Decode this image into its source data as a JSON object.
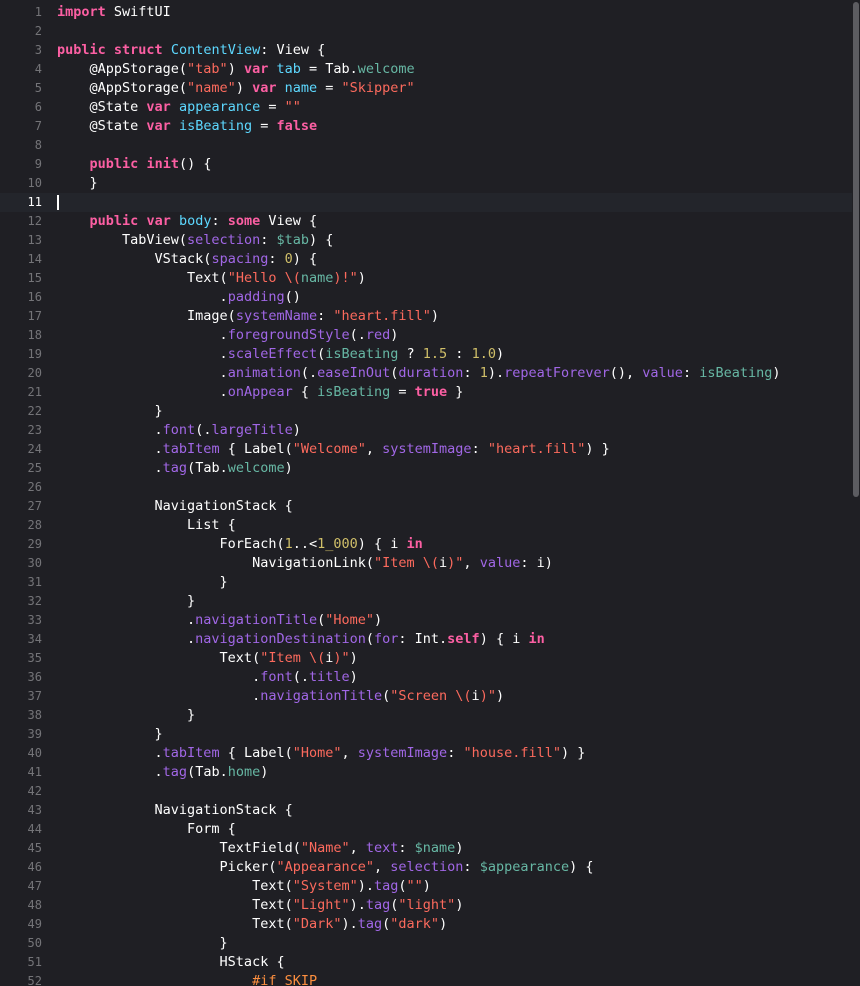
{
  "editor": {
    "current_line": 11,
    "lines": [
      {
        "n": "1",
        "t": [
          [
            "import",
            "kw"
          ],
          [
            " SwiftUI",
            "pl"
          ]
        ]
      },
      {
        "n": "2",
        "t": []
      },
      {
        "n": "3",
        "t": [
          [
            "public",
            "kw"
          ],
          [
            " ",
            "pl"
          ],
          [
            "struct",
            "kw"
          ],
          [
            " ",
            "pl"
          ],
          [
            "ContentView",
            "typ"
          ],
          [
            ": View {",
            "pl"
          ]
        ]
      },
      {
        "n": "4",
        "t": [
          [
            "    @AppStorage(",
            "pl"
          ],
          [
            "\"tab\"",
            "str"
          ],
          [
            ") ",
            "pl"
          ],
          [
            "var",
            "kw"
          ],
          [
            " ",
            "pl"
          ],
          [
            "tab",
            "typ"
          ],
          [
            " = Tab.",
            "pl"
          ],
          [
            "welcome",
            "prop"
          ]
        ]
      },
      {
        "n": "5",
        "t": [
          [
            "    @AppStorage(",
            "pl"
          ],
          [
            "\"name\"",
            "str"
          ],
          [
            ") ",
            "pl"
          ],
          [
            "var",
            "kw"
          ],
          [
            " ",
            "pl"
          ],
          [
            "name",
            "typ"
          ],
          [
            " = ",
            "pl"
          ],
          [
            "\"Skipper\"",
            "str"
          ]
        ]
      },
      {
        "n": "6",
        "t": [
          [
            "    @State ",
            "pl"
          ],
          [
            "var",
            "kw"
          ],
          [
            " ",
            "pl"
          ],
          [
            "appearance",
            "typ"
          ],
          [
            " = ",
            "pl"
          ],
          [
            "\"\"",
            "str"
          ]
        ]
      },
      {
        "n": "7",
        "t": [
          [
            "    @State ",
            "pl"
          ],
          [
            "var",
            "kw"
          ],
          [
            " ",
            "pl"
          ],
          [
            "isBeating",
            "typ"
          ],
          [
            " = ",
            "pl"
          ],
          [
            "false",
            "kw"
          ]
        ]
      },
      {
        "n": "8",
        "t": []
      },
      {
        "n": "9",
        "t": [
          [
            "    ",
            "pl"
          ],
          [
            "public",
            "kw"
          ],
          [
            " ",
            "pl"
          ],
          [
            "init",
            "kw"
          ],
          [
            "() {",
            "pl"
          ]
        ]
      },
      {
        "n": "10",
        "t": [
          [
            "    }",
            "pl"
          ]
        ]
      },
      {
        "n": "11",
        "t": []
      },
      {
        "n": "12",
        "t": [
          [
            "    ",
            "pl"
          ],
          [
            "public",
            "kw"
          ],
          [
            " ",
            "pl"
          ],
          [
            "var",
            "kw"
          ],
          [
            " ",
            "pl"
          ],
          [
            "body",
            "typ"
          ],
          [
            ": ",
            "pl"
          ],
          [
            "some",
            "kw"
          ],
          [
            " View {",
            "pl"
          ]
        ]
      },
      {
        "n": "13",
        "t": [
          [
            "        TabView(",
            "pl"
          ],
          [
            "selection",
            "fn"
          ],
          [
            ": ",
            "pl"
          ],
          [
            "$tab",
            "prop"
          ],
          [
            ") {",
            "pl"
          ]
        ]
      },
      {
        "n": "14",
        "t": [
          [
            "            VStack(",
            "pl"
          ],
          [
            "spacing",
            "fn"
          ],
          [
            ": ",
            "pl"
          ],
          [
            "0",
            "num"
          ],
          [
            ") {",
            "pl"
          ]
        ]
      },
      {
        "n": "15",
        "t": [
          [
            "                Text(",
            "pl"
          ],
          [
            "\"Hello \\(",
            "str"
          ],
          [
            "name",
            "prop"
          ],
          [
            ")!\"",
            "str"
          ],
          [
            ")",
            "pl"
          ]
        ]
      },
      {
        "n": "16",
        "t": [
          [
            "                    .",
            "pl"
          ],
          [
            "padding",
            "fn"
          ],
          [
            "()",
            "pl"
          ]
        ]
      },
      {
        "n": "17",
        "t": [
          [
            "                Image(",
            "pl"
          ],
          [
            "systemName",
            "fn"
          ],
          [
            ": ",
            "pl"
          ],
          [
            "\"heart.fill\"",
            "str"
          ],
          [
            ")",
            "pl"
          ]
        ]
      },
      {
        "n": "18",
        "t": [
          [
            "                    .",
            "pl"
          ],
          [
            "foregroundStyle",
            "fn"
          ],
          [
            "(.",
            "pl"
          ],
          [
            "red",
            "fn"
          ],
          [
            ")",
            "pl"
          ]
        ]
      },
      {
        "n": "19",
        "t": [
          [
            "                    .",
            "pl"
          ],
          [
            "scaleEffect",
            "fn"
          ],
          [
            "(",
            "pl"
          ],
          [
            "isBeating",
            "prop"
          ],
          [
            " ? ",
            "pl"
          ],
          [
            "1.5",
            "num"
          ],
          [
            " : ",
            "pl"
          ],
          [
            "1.0",
            "num"
          ],
          [
            ")",
            "pl"
          ]
        ]
      },
      {
        "n": "20",
        "t": [
          [
            "                    .",
            "pl"
          ],
          [
            "animation",
            "fn"
          ],
          [
            "(.",
            "pl"
          ],
          [
            "easeInOut",
            "fn"
          ],
          [
            "(",
            "pl"
          ],
          [
            "duration",
            "fn"
          ],
          [
            ": ",
            "pl"
          ],
          [
            "1",
            "num"
          ],
          [
            ").",
            "pl"
          ],
          [
            "repeatForever",
            "fn"
          ],
          [
            "(), ",
            "pl"
          ],
          [
            "value",
            "fn"
          ],
          [
            ": ",
            "pl"
          ],
          [
            "isBeating",
            "prop"
          ],
          [
            ")",
            "pl"
          ]
        ]
      },
      {
        "n": "21",
        "t": [
          [
            "                    .",
            "pl"
          ],
          [
            "onAppear",
            "fn"
          ],
          [
            " { ",
            "pl"
          ],
          [
            "isBeating",
            "prop"
          ],
          [
            " = ",
            "pl"
          ],
          [
            "true",
            "kw"
          ],
          [
            " }",
            "pl"
          ]
        ]
      },
      {
        "n": "22",
        "t": [
          [
            "            }",
            "pl"
          ]
        ]
      },
      {
        "n": "23",
        "t": [
          [
            "            .",
            "pl"
          ],
          [
            "font",
            "fn"
          ],
          [
            "(.",
            "pl"
          ],
          [
            "largeTitle",
            "fn"
          ],
          [
            ")",
            "pl"
          ]
        ]
      },
      {
        "n": "24",
        "t": [
          [
            "            .",
            "pl"
          ],
          [
            "tabItem",
            "fn"
          ],
          [
            " { Label(",
            "pl"
          ],
          [
            "\"Welcome\"",
            "str"
          ],
          [
            ", ",
            "pl"
          ],
          [
            "systemImage",
            "fn"
          ],
          [
            ": ",
            "pl"
          ],
          [
            "\"heart.fill\"",
            "str"
          ],
          [
            ") }",
            "pl"
          ]
        ]
      },
      {
        "n": "25",
        "t": [
          [
            "            .",
            "pl"
          ],
          [
            "tag",
            "fn"
          ],
          [
            "(Tab.",
            "pl"
          ],
          [
            "welcome",
            "prop"
          ],
          [
            ")",
            "pl"
          ]
        ]
      },
      {
        "n": "26",
        "t": []
      },
      {
        "n": "27",
        "t": [
          [
            "            NavigationStack {",
            "pl"
          ]
        ]
      },
      {
        "n": "28",
        "t": [
          [
            "                List {",
            "pl"
          ]
        ]
      },
      {
        "n": "29",
        "t": [
          [
            "                    ForEach(",
            "pl"
          ],
          [
            "1",
            "num"
          ],
          [
            "..<",
            "pl"
          ],
          [
            "1_000",
            "num"
          ],
          [
            ") { i ",
            "pl"
          ],
          [
            "in",
            "kw"
          ]
        ]
      },
      {
        "n": "30",
        "t": [
          [
            "                        NavigationLink(",
            "pl"
          ],
          [
            "\"Item \\(",
            "str"
          ],
          [
            "i",
            "pl"
          ],
          [
            ")\"",
            "str"
          ],
          [
            ", ",
            "pl"
          ],
          [
            "value",
            "fn"
          ],
          [
            ": i)",
            "pl"
          ]
        ]
      },
      {
        "n": "31",
        "t": [
          [
            "                    }",
            "pl"
          ]
        ]
      },
      {
        "n": "32",
        "t": [
          [
            "                }",
            "pl"
          ]
        ]
      },
      {
        "n": "33",
        "t": [
          [
            "                .",
            "pl"
          ],
          [
            "navigationTitle",
            "fn"
          ],
          [
            "(",
            "pl"
          ],
          [
            "\"Home\"",
            "str"
          ],
          [
            ")",
            "pl"
          ]
        ]
      },
      {
        "n": "34",
        "t": [
          [
            "                .",
            "pl"
          ],
          [
            "navigationDestination",
            "fn"
          ],
          [
            "(",
            "pl"
          ],
          [
            "for",
            "fn"
          ],
          [
            ": Int.",
            "pl"
          ],
          [
            "self",
            "kw"
          ],
          [
            ") { i ",
            "pl"
          ],
          [
            "in",
            "kw"
          ]
        ]
      },
      {
        "n": "35",
        "t": [
          [
            "                    Text(",
            "pl"
          ],
          [
            "\"Item \\(",
            "str"
          ],
          [
            "i",
            "pl"
          ],
          [
            ")\"",
            "str"
          ],
          [
            ")",
            "pl"
          ]
        ]
      },
      {
        "n": "36",
        "t": [
          [
            "                        .",
            "pl"
          ],
          [
            "font",
            "fn"
          ],
          [
            "(.",
            "pl"
          ],
          [
            "title",
            "fn"
          ],
          [
            ")",
            "pl"
          ]
        ]
      },
      {
        "n": "37",
        "t": [
          [
            "                        .",
            "pl"
          ],
          [
            "navigationTitle",
            "fn"
          ],
          [
            "(",
            "pl"
          ],
          [
            "\"Screen \\(",
            "str"
          ],
          [
            "i",
            "pl"
          ],
          [
            ")\"",
            "str"
          ],
          [
            ")",
            "pl"
          ]
        ]
      },
      {
        "n": "38",
        "t": [
          [
            "                }",
            "pl"
          ]
        ]
      },
      {
        "n": "39",
        "t": [
          [
            "            }",
            "pl"
          ]
        ]
      },
      {
        "n": "40",
        "t": [
          [
            "            .",
            "pl"
          ],
          [
            "tabItem",
            "fn"
          ],
          [
            " { Label(",
            "pl"
          ],
          [
            "\"Home\"",
            "str"
          ],
          [
            ", ",
            "pl"
          ],
          [
            "systemImage",
            "fn"
          ],
          [
            ": ",
            "pl"
          ],
          [
            "\"house.fill\"",
            "str"
          ],
          [
            ") }",
            "pl"
          ]
        ]
      },
      {
        "n": "41",
        "t": [
          [
            "            .",
            "pl"
          ],
          [
            "tag",
            "fn"
          ],
          [
            "(Tab.",
            "pl"
          ],
          [
            "home",
            "prop"
          ],
          [
            ")",
            "pl"
          ]
        ]
      },
      {
        "n": "42",
        "t": []
      },
      {
        "n": "43",
        "t": [
          [
            "            NavigationStack {",
            "pl"
          ]
        ]
      },
      {
        "n": "44",
        "t": [
          [
            "                Form {",
            "pl"
          ]
        ]
      },
      {
        "n": "45",
        "t": [
          [
            "                    TextField(",
            "pl"
          ],
          [
            "\"Name\"",
            "str"
          ],
          [
            ", ",
            "pl"
          ],
          [
            "text",
            "fn"
          ],
          [
            ": ",
            "pl"
          ],
          [
            "$name",
            "prop"
          ],
          [
            ")",
            "pl"
          ]
        ]
      },
      {
        "n": "46",
        "t": [
          [
            "                    Picker(",
            "pl"
          ],
          [
            "\"Appearance\"",
            "str"
          ],
          [
            ", ",
            "pl"
          ],
          [
            "selection",
            "fn"
          ],
          [
            ": ",
            "pl"
          ],
          [
            "$appearance",
            "prop"
          ],
          [
            ") {",
            "pl"
          ]
        ]
      },
      {
        "n": "47",
        "t": [
          [
            "                        Text(",
            "pl"
          ],
          [
            "\"System\"",
            "str"
          ],
          [
            ").",
            "pl"
          ],
          [
            "tag",
            "fn"
          ],
          [
            "(",
            "pl"
          ],
          [
            "\"\"",
            "str"
          ],
          [
            ")",
            "pl"
          ]
        ]
      },
      {
        "n": "48",
        "t": [
          [
            "                        Text(",
            "pl"
          ],
          [
            "\"Light\"",
            "str"
          ],
          [
            ").",
            "pl"
          ],
          [
            "tag",
            "fn"
          ],
          [
            "(",
            "pl"
          ],
          [
            "\"light\"",
            "str"
          ],
          [
            ")",
            "pl"
          ]
        ]
      },
      {
        "n": "49",
        "t": [
          [
            "                        Text(",
            "pl"
          ],
          [
            "\"Dark\"",
            "str"
          ],
          [
            ").",
            "pl"
          ],
          [
            "tag",
            "fn"
          ],
          [
            "(",
            "pl"
          ],
          [
            "\"dark\"",
            "str"
          ],
          [
            ")",
            "pl"
          ]
        ]
      },
      {
        "n": "50",
        "t": [
          [
            "                    }",
            "pl"
          ]
        ]
      },
      {
        "n": "51",
        "t": [
          [
            "                    HStack {",
            "pl"
          ]
        ]
      },
      {
        "n": "52",
        "t": [
          [
            "                        ",
            "pl"
          ],
          [
            "#if SKIP",
            "pre"
          ]
        ]
      }
    ]
  }
}
